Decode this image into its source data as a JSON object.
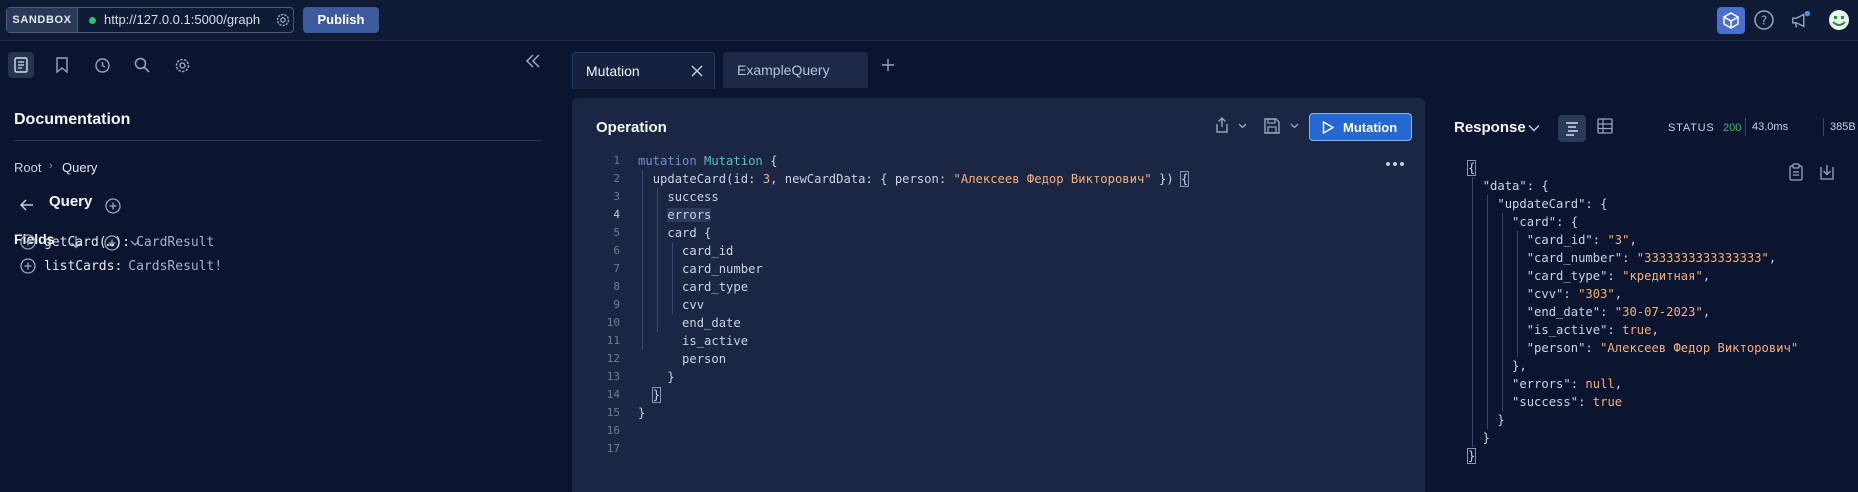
{
  "topbar": {
    "sandbox_label": "SANDBOX",
    "endpoint_url": "http://127.0.0.1:5000/graph",
    "publish_label": "Publish"
  },
  "left": {
    "title": "Documentation",
    "breadcrumb": [
      "Root",
      "Query"
    ],
    "query_heading": "Query",
    "fields_heading": "Fields",
    "fields": [
      {
        "name": "getCard(…):",
        "type": "CardResult"
      },
      {
        "name": "listCards:",
        "type": "CardsResult!"
      }
    ]
  },
  "tabs": [
    {
      "label": "Mutation",
      "active": true
    },
    {
      "label": "ExampleQuery",
      "active": false
    }
  ],
  "editor": {
    "title": "Operation",
    "run_label": "Mutation",
    "current_line": 4,
    "line_numbers": [
      "1",
      "2",
      "3",
      "4",
      "5",
      "6",
      "7",
      "8",
      "9",
      "10",
      "11",
      "12",
      "13",
      "14",
      "15",
      "16",
      "17"
    ],
    "code": {
      "l1_kw": "mutation",
      "l1_name": "Mutation",
      "l1_brace": " {",
      "l2_field": "updateCard",
      "l2_a": "(id: ",
      "l2_id": "3",
      "l2_b": ", newCardData: { person: ",
      "l2_str": "\"Алексеев Федор Викторович\"",
      "l2_c": " }) ",
      "l2_brace": "{",
      "l3": "success",
      "l4": "errors",
      "l5": "card {",
      "l6": "card_id",
      "l7": "card_number",
      "l8": "card_type",
      "l9": "cvv",
      "l10": "end_date",
      "l11": "is_active",
      "l12": "person",
      "l13": "}",
      "l14": "}",
      "l15": "}"
    }
  },
  "response": {
    "title": "Response",
    "status_label": "STATUS",
    "status_code": "200",
    "time": "43.0ms",
    "size": "385B",
    "json": {
      "data_key": "\"data\"",
      "update_key": "\"updateCard\"",
      "card_key": "\"card\"",
      "card_id_key": "\"card_id\"",
      "card_id_val": "\"3\"",
      "card_number_key": "\"card_number\"",
      "card_number_val": "\"3333333333333333\"",
      "card_type_key": "\"card_type\"",
      "card_type_val": "\"кредитная\"",
      "cvv_key": "\"cvv\"",
      "cvv_val": "\"303\"",
      "end_date_key": "\"end_date\"",
      "end_date_val": "\"30-07-2023\"",
      "is_active_key": "\"is_active\"",
      "is_active_val": "true",
      "person_key": "\"person\"",
      "person_val": "\"Алексеев Федор Викторович\"",
      "errors_key": "\"errors\"",
      "errors_val": "null",
      "success_key": "\"success\"",
      "success_val": "true"
    }
  }
}
